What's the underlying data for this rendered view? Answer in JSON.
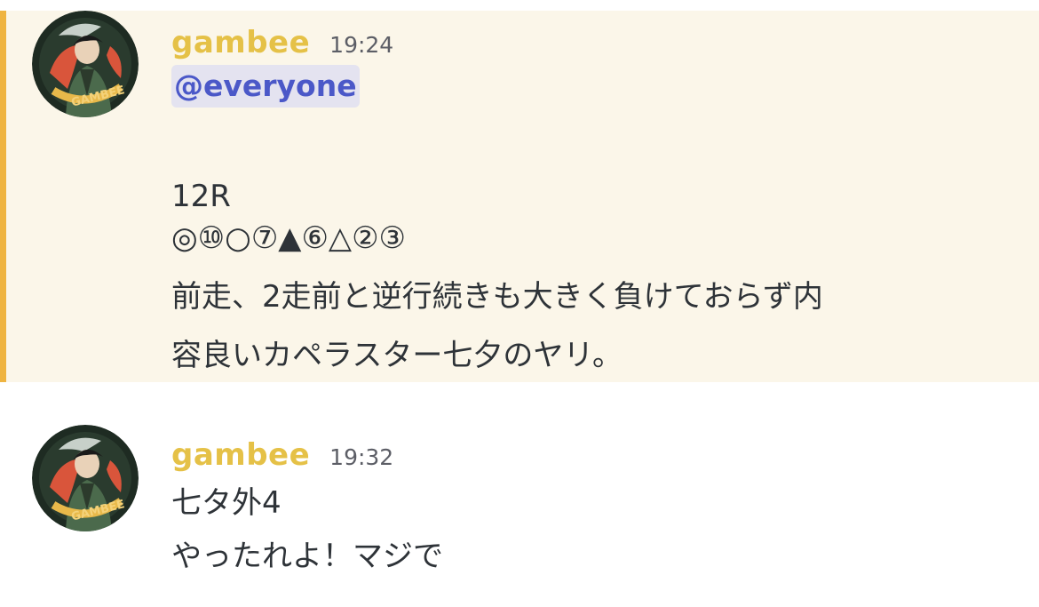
{
  "messages": [
    {
      "username": "gambee",
      "timestamp": "19:24",
      "mention": "@everyone",
      "lines": [
        "12R",
        "◎⑩○⑦▲⑥△②③",
        "前走、2走前と逆行続きも大きく負けておらず内",
        "容良いカペラスター七夕のヤリ。"
      ],
      "highlight_color": "#fbf6e9",
      "bar_color": "#efb441"
    },
    {
      "username": "gambee",
      "timestamp": "19:32",
      "lines": [
        "七タ外4",
        "やったれよ！マジで"
      ]
    }
  ],
  "colors": {
    "username": "#e5c147",
    "mention_text": "#4b58c8",
    "mention_bg": "#e4e3f0"
  }
}
